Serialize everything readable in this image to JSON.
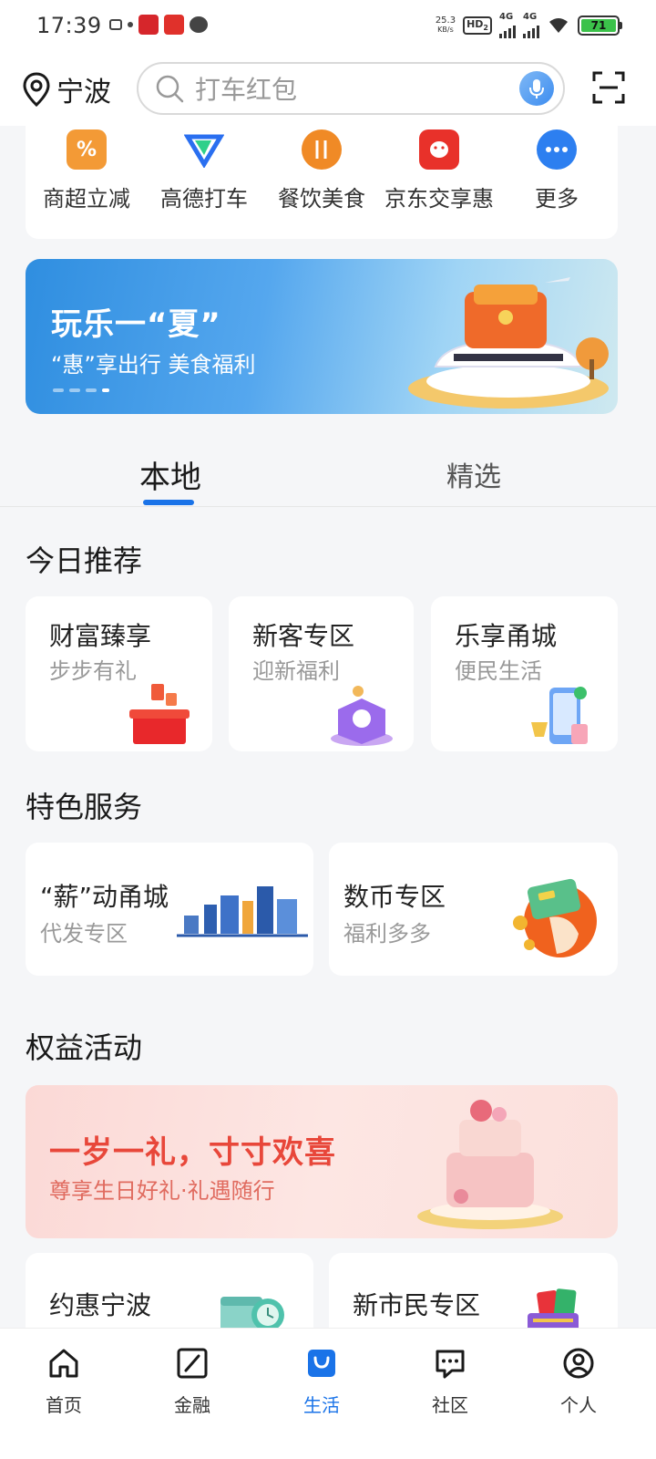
{
  "status_bar": {
    "time": "17:39",
    "net_speed_value": "25.3",
    "net_speed_unit": "KB/s",
    "hd_label": "HD",
    "hd_sub": "2",
    "sig1_label": "4G",
    "sig2_label": "4G",
    "battery": "71"
  },
  "header": {
    "location": "宁波",
    "search_placeholder": "打车红包"
  },
  "services": [
    {
      "label": "商超立减",
      "icon": "percent-tag-icon",
      "color": "#f39a36"
    },
    {
      "label": "高德打车",
      "icon": "amap-taxi-icon",
      "color": "#2a6ff0"
    },
    {
      "label": "餐饮美食",
      "icon": "fork-knife-icon",
      "color": "#f08a26"
    },
    {
      "label": "京东交享惠",
      "icon": "jd-dog-icon",
      "color": "#e8312a"
    },
    {
      "label": "更多",
      "icon": "more-dots-icon",
      "color": "#2d7ff0"
    }
  ],
  "banner": {
    "title": "玩乐一“夏”",
    "subtitle": "“惠”享出行 美食福利"
  },
  "tabs": [
    {
      "label": "本地"
    },
    {
      "label": "精选"
    }
  ],
  "today": {
    "title": "今日推荐",
    "cards": [
      {
        "title": "财富臻享",
        "sub": "步步有礼"
      },
      {
        "title": "新客专区",
        "sub": "迎新福利"
      },
      {
        "title": "乐享甬城",
        "sub": "便民生活"
      }
    ]
  },
  "featured": {
    "title": "特色服务",
    "cards": [
      {
        "title": "“薪”动甬城",
        "sub": "代发专区"
      },
      {
        "title": "数币专区",
        "sub": "福利多多"
      }
    ]
  },
  "benefits": {
    "title": "权益活动",
    "banner_title": "一岁一礼，寸寸欢喜",
    "banner_sub": "尊享生日好礼·礼遇随行",
    "cards": [
      {
        "title": "约惠宁波"
      },
      {
        "title": "新市民专区"
      }
    ]
  },
  "bottom_nav": [
    {
      "label": "首页",
      "icon": "home-icon"
    },
    {
      "label": "金融",
      "icon": "finance-icon"
    },
    {
      "label": "生活",
      "icon": "life-bag-icon",
      "active": true
    },
    {
      "label": "社区",
      "icon": "community-chat-icon"
    },
    {
      "label": "个人",
      "icon": "profile-icon"
    }
  ],
  "colors": {
    "accent": "#1a73e8",
    "bday_red": "#e8473a"
  }
}
